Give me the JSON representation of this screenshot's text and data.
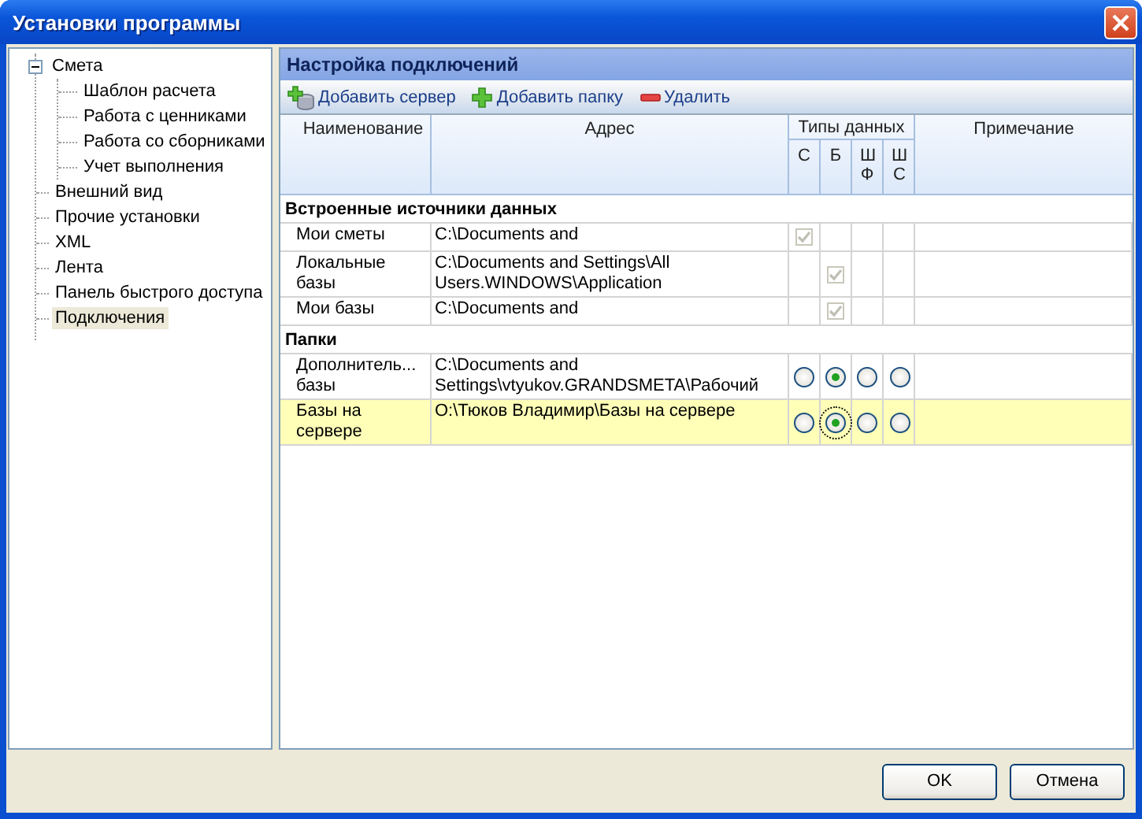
{
  "window": {
    "title": "Установки программы"
  },
  "tree": [
    {
      "label": "Смета",
      "selected": false,
      "expanded": true,
      "children": [
        {
          "label": "Шаблон расчета",
          "selected": false
        },
        {
          "label": "Работа с ценниками",
          "selected": false
        },
        {
          "label": "Работа со сборниками",
          "selected": false
        },
        {
          "label": "Учет выполнения",
          "selected": false
        }
      ]
    },
    {
      "label": "Внешний вид",
      "selected": false
    },
    {
      "label": "Прочие установки",
      "selected": false
    },
    {
      "label": "XML",
      "selected": false
    },
    {
      "label": "Лента",
      "selected": false
    },
    {
      "label": "Панель быстрого доступа",
      "selected": false
    },
    {
      "label": "Подключения",
      "selected": true
    }
  ],
  "panel": {
    "title": "Настройка подключений"
  },
  "toolbar": [
    {
      "kind": "add-server",
      "label": "Добавить сервер"
    },
    {
      "kind": "add-folder",
      "label": "Добавить папку"
    },
    {
      "kind": "delete",
      "label": "Удалить"
    }
  ],
  "table": {
    "columns": {
      "name": "Наименование",
      "address": "Адрес",
      "types": "Типы данных",
      "type_columns": [
        "С",
        "Б",
        "Ш Ф",
        "Ш С"
      ],
      "note": "Примечание"
    },
    "groups": [
      {
        "title": "Встроенные источники данных",
        "rows": [
          {
            "name": "Мои сметы",
            "address": "C:\\Documents and",
            "selected": false,
            "cells": [
              {
                "kind": "checkbox",
                "checked": true
              },
              {
                "kind": "empty"
              },
              {
                "kind": "empty"
              },
              {
                "kind": "empty"
              }
            ]
          },
          {
            "name": "Локальные базы",
            "address": "C:\\Documents and Settings\\All Users.WINDOWS\\Application",
            "selected": false,
            "cells": [
              {
                "kind": "empty"
              },
              {
                "kind": "checkbox",
                "checked": true
              },
              {
                "kind": "empty"
              },
              {
                "kind": "empty"
              }
            ]
          },
          {
            "name": "Мои базы",
            "address": "C:\\Documents and",
            "selected": false,
            "cells": [
              {
                "kind": "empty"
              },
              {
                "kind": "checkbox",
                "checked": true
              },
              {
                "kind": "empty"
              },
              {
                "kind": "empty"
              }
            ]
          }
        ]
      },
      {
        "title": "Папки",
        "rows": [
          {
            "name": "Дополнитель... базы",
            "address": "C:\\Documents and Settings\\vtyukov.GRANDSMETA\\Рабочий",
            "selected": false,
            "cells": [
              {
                "kind": "radio",
                "selected": false
              },
              {
                "kind": "radio",
                "selected": true
              },
              {
                "kind": "radio",
                "selected": false
              },
              {
                "kind": "radio",
                "selected": false
              }
            ]
          },
          {
            "name": "Базы на сервере",
            "address": "O:\\Тюков Владимир\\Базы на сервере",
            "selected": true,
            "cells": [
              {
                "kind": "radio",
                "selected": false
              },
              {
                "kind": "radio",
                "selected": true
              },
              {
                "kind": "radio",
                "selected": false
              },
              {
                "kind": "radio",
                "selected": false
              }
            ]
          }
        ]
      }
    ]
  },
  "buttons": [
    "OK",
    "Отмена"
  ]
}
